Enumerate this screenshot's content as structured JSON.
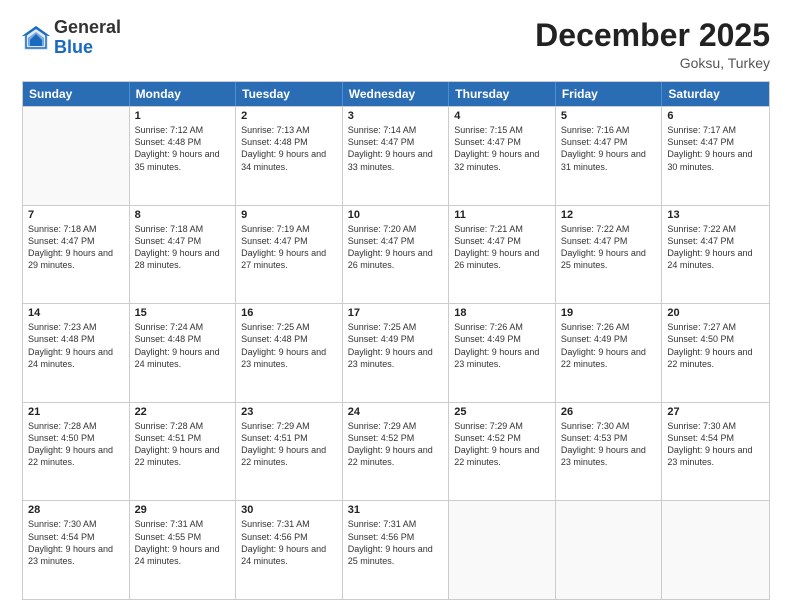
{
  "logo": {
    "general": "General",
    "blue": "Blue"
  },
  "title": "December 2025",
  "location": "Goksu, Turkey",
  "days_of_week": [
    "Sunday",
    "Monday",
    "Tuesday",
    "Wednesday",
    "Thursday",
    "Friday",
    "Saturday"
  ],
  "weeks": [
    [
      {
        "day": "",
        "sunrise": "",
        "sunset": "",
        "daylight": ""
      },
      {
        "day": "1",
        "sunrise": "Sunrise: 7:12 AM",
        "sunset": "Sunset: 4:48 PM",
        "daylight": "Daylight: 9 hours and 35 minutes."
      },
      {
        "day": "2",
        "sunrise": "Sunrise: 7:13 AM",
        "sunset": "Sunset: 4:48 PM",
        "daylight": "Daylight: 9 hours and 34 minutes."
      },
      {
        "day": "3",
        "sunrise": "Sunrise: 7:14 AM",
        "sunset": "Sunset: 4:47 PM",
        "daylight": "Daylight: 9 hours and 33 minutes."
      },
      {
        "day": "4",
        "sunrise": "Sunrise: 7:15 AM",
        "sunset": "Sunset: 4:47 PM",
        "daylight": "Daylight: 9 hours and 32 minutes."
      },
      {
        "day": "5",
        "sunrise": "Sunrise: 7:16 AM",
        "sunset": "Sunset: 4:47 PM",
        "daylight": "Daylight: 9 hours and 31 minutes."
      },
      {
        "day": "6",
        "sunrise": "Sunrise: 7:17 AM",
        "sunset": "Sunset: 4:47 PM",
        "daylight": "Daylight: 9 hours and 30 minutes."
      }
    ],
    [
      {
        "day": "7",
        "sunrise": "Sunrise: 7:18 AM",
        "sunset": "Sunset: 4:47 PM",
        "daylight": "Daylight: 9 hours and 29 minutes."
      },
      {
        "day": "8",
        "sunrise": "Sunrise: 7:18 AM",
        "sunset": "Sunset: 4:47 PM",
        "daylight": "Daylight: 9 hours and 28 minutes."
      },
      {
        "day": "9",
        "sunrise": "Sunrise: 7:19 AM",
        "sunset": "Sunset: 4:47 PM",
        "daylight": "Daylight: 9 hours and 27 minutes."
      },
      {
        "day": "10",
        "sunrise": "Sunrise: 7:20 AM",
        "sunset": "Sunset: 4:47 PM",
        "daylight": "Daylight: 9 hours and 26 minutes."
      },
      {
        "day": "11",
        "sunrise": "Sunrise: 7:21 AM",
        "sunset": "Sunset: 4:47 PM",
        "daylight": "Daylight: 9 hours and 26 minutes."
      },
      {
        "day": "12",
        "sunrise": "Sunrise: 7:22 AM",
        "sunset": "Sunset: 4:47 PM",
        "daylight": "Daylight: 9 hours and 25 minutes."
      },
      {
        "day": "13",
        "sunrise": "Sunrise: 7:22 AM",
        "sunset": "Sunset: 4:47 PM",
        "daylight": "Daylight: 9 hours and 24 minutes."
      }
    ],
    [
      {
        "day": "14",
        "sunrise": "Sunrise: 7:23 AM",
        "sunset": "Sunset: 4:48 PM",
        "daylight": "Daylight: 9 hours and 24 minutes."
      },
      {
        "day": "15",
        "sunrise": "Sunrise: 7:24 AM",
        "sunset": "Sunset: 4:48 PM",
        "daylight": "Daylight: 9 hours and 24 minutes."
      },
      {
        "day": "16",
        "sunrise": "Sunrise: 7:25 AM",
        "sunset": "Sunset: 4:48 PM",
        "daylight": "Daylight: 9 hours and 23 minutes."
      },
      {
        "day": "17",
        "sunrise": "Sunrise: 7:25 AM",
        "sunset": "Sunset: 4:49 PM",
        "daylight": "Daylight: 9 hours and 23 minutes."
      },
      {
        "day": "18",
        "sunrise": "Sunrise: 7:26 AM",
        "sunset": "Sunset: 4:49 PM",
        "daylight": "Daylight: 9 hours and 23 minutes."
      },
      {
        "day": "19",
        "sunrise": "Sunrise: 7:26 AM",
        "sunset": "Sunset: 4:49 PM",
        "daylight": "Daylight: 9 hours and 22 minutes."
      },
      {
        "day": "20",
        "sunrise": "Sunrise: 7:27 AM",
        "sunset": "Sunset: 4:50 PM",
        "daylight": "Daylight: 9 hours and 22 minutes."
      }
    ],
    [
      {
        "day": "21",
        "sunrise": "Sunrise: 7:28 AM",
        "sunset": "Sunset: 4:50 PM",
        "daylight": "Daylight: 9 hours and 22 minutes."
      },
      {
        "day": "22",
        "sunrise": "Sunrise: 7:28 AM",
        "sunset": "Sunset: 4:51 PM",
        "daylight": "Daylight: 9 hours and 22 minutes."
      },
      {
        "day": "23",
        "sunrise": "Sunrise: 7:29 AM",
        "sunset": "Sunset: 4:51 PM",
        "daylight": "Daylight: 9 hours and 22 minutes."
      },
      {
        "day": "24",
        "sunrise": "Sunrise: 7:29 AM",
        "sunset": "Sunset: 4:52 PM",
        "daylight": "Daylight: 9 hours and 22 minutes."
      },
      {
        "day": "25",
        "sunrise": "Sunrise: 7:29 AM",
        "sunset": "Sunset: 4:52 PM",
        "daylight": "Daylight: 9 hours and 22 minutes."
      },
      {
        "day": "26",
        "sunrise": "Sunrise: 7:30 AM",
        "sunset": "Sunset: 4:53 PM",
        "daylight": "Daylight: 9 hours and 23 minutes."
      },
      {
        "day": "27",
        "sunrise": "Sunrise: 7:30 AM",
        "sunset": "Sunset: 4:54 PM",
        "daylight": "Daylight: 9 hours and 23 minutes."
      }
    ],
    [
      {
        "day": "28",
        "sunrise": "Sunrise: 7:30 AM",
        "sunset": "Sunset: 4:54 PM",
        "daylight": "Daylight: 9 hours and 23 minutes."
      },
      {
        "day": "29",
        "sunrise": "Sunrise: 7:31 AM",
        "sunset": "Sunset: 4:55 PM",
        "daylight": "Daylight: 9 hours and 24 minutes."
      },
      {
        "day": "30",
        "sunrise": "Sunrise: 7:31 AM",
        "sunset": "Sunset: 4:56 PM",
        "daylight": "Daylight: 9 hours and 24 minutes."
      },
      {
        "day": "31",
        "sunrise": "Sunrise: 7:31 AM",
        "sunset": "Sunset: 4:56 PM",
        "daylight": "Daylight: 9 hours and 25 minutes."
      },
      {
        "day": "",
        "sunrise": "",
        "sunset": "",
        "daylight": ""
      },
      {
        "day": "",
        "sunrise": "",
        "sunset": "",
        "daylight": ""
      },
      {
        "day": "",
        "sunrise": "",
        "sunset": "",
        "daylight": ""
      }
    ]
  ]
}
